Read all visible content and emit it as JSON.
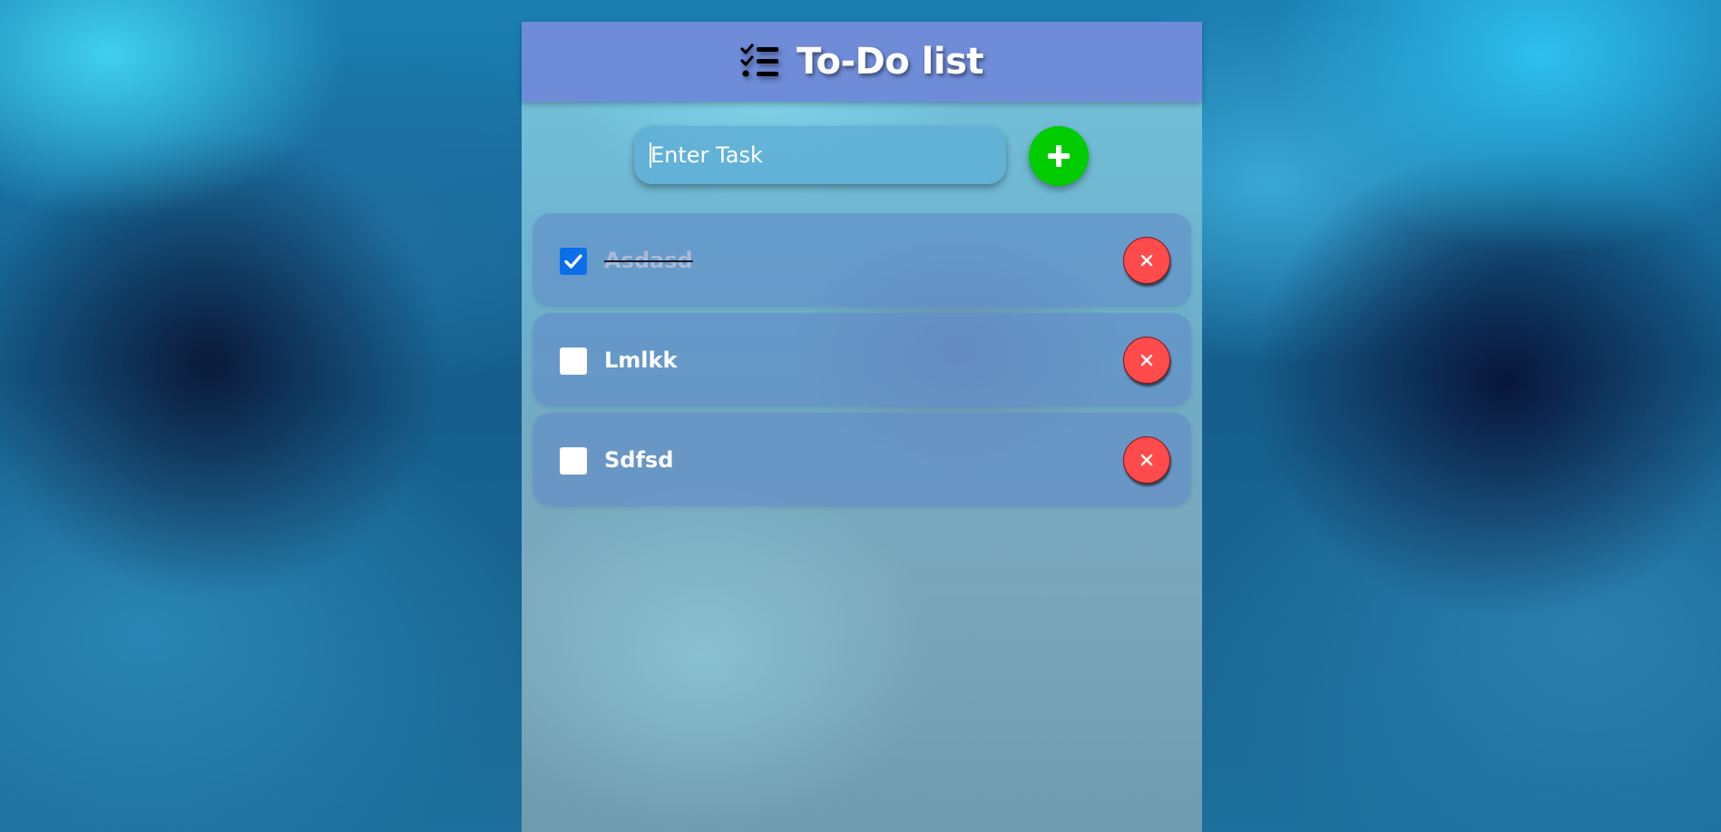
{
  "header": {
    "title": "To-Do list",
    "icon": "checklist-icon"
  },
  "input": {
    "placeholder": "Enter Task",
    "value": ""
  },
  "add_button": {
    "icon": "plus-icon",
    "color": "#00cc00"
  },
  "tasks": [
    {
      "text": "Asdasd",
      "checked": true
    },
    {
      "text": "Lmlkk",
      "checked": false
    },
    {
      "text": "Sdfsd",
      "checked": false
    }
  ],
  "delete_button": {
    "icon": "close-icon",
    "color": "#ff4b4b"
  },
  "colors": {
    "header": "#6f8cd9",
    "checkbox_checked": "#0a6fe8"
  }
}
